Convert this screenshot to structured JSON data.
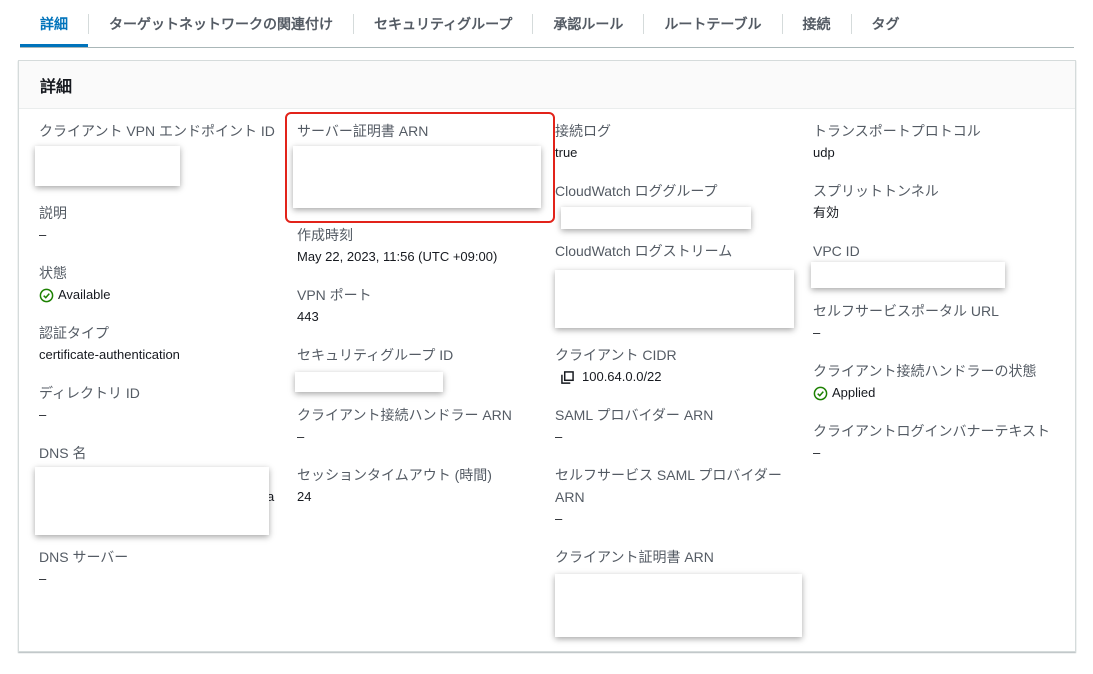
{
  "tabs": [
    "詳細",
    "ターゲットネットワークの関連付け",
    "セキュリティグループ",
    "承認ルール",
    "ルートテーブル",
    "接続",
    "タグ"
  ],
  "panel": {
    "title": "詳細"
  },
  "col1": {
    "endpoint_id_label": "クライアント VPN エンドポイント ID",
    "description_label": "説明",
    "description_value": "–",
    "state_label": "状態",
    "state_value": "Available",
    "auth_type_label": "認証タイプ",
    "auth_type_value": "certificate-authentication",
    "directory_id_label": "ディレクトリ ID",
    "directory_id_value": "–",
    "dns_name_label": "DNS 名",
    "dns_name_fragment": "a",
    "dns_server_label": "DNS サーバー",
    "dns_server_value": "–"
  },
  "col2": {
    "server_cert_label": "サーバー証明書 ARN",
    "created_label": "作成時刻",
    "created_value": "May 22, 2023, 11:56 (UTC +09:00)",
    "vpn_port_label": "VPN ポート",
    "vpn_port_value": "443",
    "sg_id_label": "セキュリティグループ ID",
    "handler_arn_label": "クライアント接続ハンドラー ARN",
    "handler_arn_value": "–",
    "session_timeout_label": "セッションタイムアウト (時間)",
    "session_timeout_value": "24"
  },
  "col3": {
    "conn_log_label": "接続ログ",
    "conn_log_value": "true",
    "cw_group_label": "CloudWatch ロググループ",
    "cw_stream_label": "CloudWatch ログストリーム",
    "client_cidr_label": "クライアント CIDR",
    "client_cidr_value": "100.64.0.0/22",
    "saml_label": "SAML プロバイダー ARN",
    "saml_value": "–",
    "self_saml_label_1": "セルフサービス SAML プロバイダー",
    "self_saml_label_2": "ARN",
    "self_saml_value": "–",
    "client_cert_label": "クライアント証明書 ARN"
  },
  "col4": {
    "transport_label": "トランスポートプロトコル",
    "transport_value": "udp",
    "split_label": "スプリットトンネル",
    "split_value": "有効",
    "vpc_id_label": "VPC ID",
    "portal_url_label": "セルフサービスポータル URL",
    "portal_url_value": "–",
    "handler_state_label": "クライアント接続ハンドラーの状態",
    "handler_state_value": "Applied",
    "banner_label": "クライアントログインバナーテキスト",
    "banner_value": "–"
  },
  "icons": {
    "status_ok": "check-circle-icon",
    "copy": "copy-icon"
  },
  "colors": {
    "accent": "#0073bb",
    "success": "#1d8102",
    "highlight": "#e2231a"
  }
}
